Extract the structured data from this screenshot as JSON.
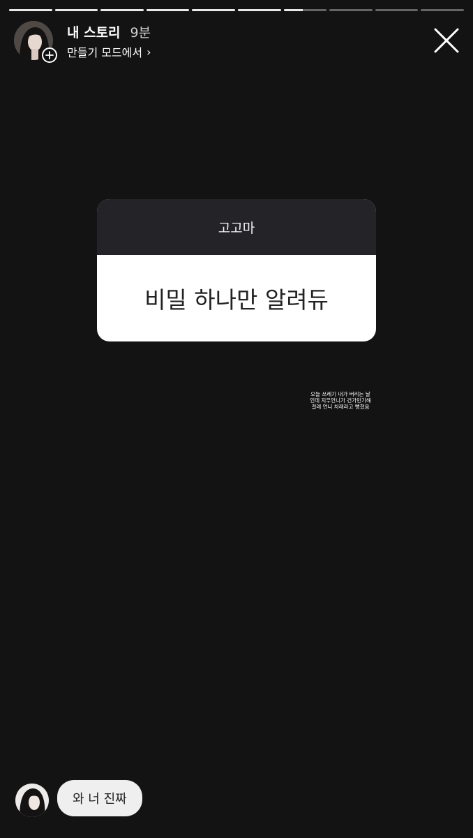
{
  "progress": {
    "segments": 10,
    "current_index": 6,
    "current_fraction": 0.45
  },
  "header": {
    "title": "내 스토리",
    "time": "9분",
    "mode_link": "만들기 모드에서",
    "mode_chevron": "›",
    "icons": {
      "avatar": "profile-avatar",
      "add": "plus-circle-icon",
      "close": "close-icon"
    }
  },
  "sticker": {
    "asker": "고고마",
    "question": "비밀 하나만 알려듀",
    "colors": {
      "header_bg": "#242428",
      "body_bg": "#ffffff"
    }
  },
  "caption": {
    "lines": [
      "오늘 쓰레기 내가 버리는 날",
      "인데 지우언니가 건가민기해",
      "걸래 언니 차래라고 뻥쳤음"
    ]
  },
  "reply": {
    "text": "와 너 진짜"
  }
}
